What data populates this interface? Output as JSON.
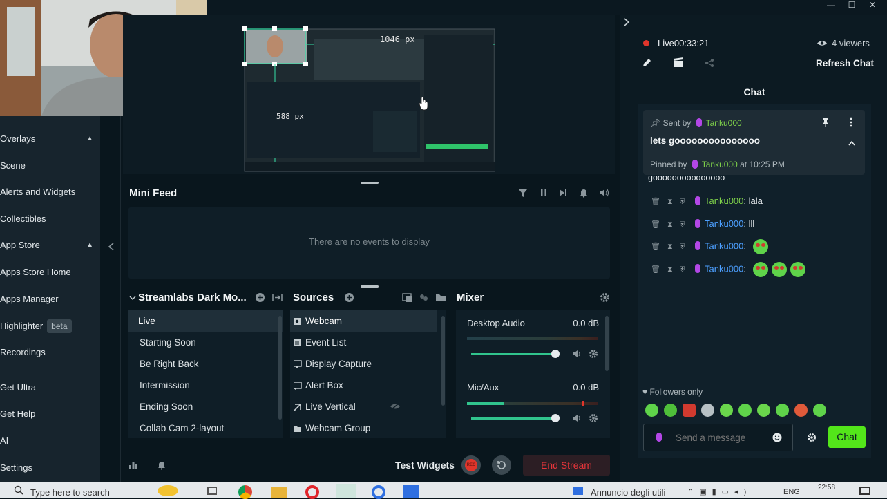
{
  "window": {
    "controls": [
      "—",
      "☐",
      "✕"
    ]
  },
  "sidebar": {
    "items": [
      {
        "label": "Overlays",
        "chevron": "▲"
      },
      {
        "label": "Scene"
      },
      {
        "label": "Alerts and Widgets"
      },
      {
        "label": "Collectibles"
      },
      {
        "label": "App Store",
        "chevron": "▲"
      },
      {
        "label": "Apps Store Home"
      },
      {
        "label": "Apps Manager"
      },
      {
        "label": "Highlighter",
        "badge": "beta"
      },
      {
        "label": "Recordings"
      },
      {
        "label": "Get Ultra"
      },
      {
        "label": "Get Help"
      },
      {
        "label": "AI"
      },
      {
        "label": "Settings"
      }
    ]
  },
  "preview": {
    "width_label": "1046 px",
    "height_label": "588 px"
  },
  "minifeed": {
    "title": "Mini Feed",
    "empty": "There are no events to display"
  },
  "scenes": {
    "title": "Streamlabs Dark Mo...",
    "items": [
      "Live",
      "Starting Soon",
      "Be Right Back",
      "Intermission",
      "Ending Soon",
      "Collab Cam 2-layout"
    ],
    "selected": "Live"
  },
  "sources": {
    "title": "Sources",
    "items": [
      "Webcam",
      "Event List",
      "Display Capture",
      "Alert Box",
      "Live Vertical",
      "Webcam Group"
    ],
    "selected": "Webcam"
  },
  "mixer": {
    "title": "Mixer",
    "channels": [
      {
        "name": "Desktop Audio",
        "level": "0.0 dB"
      },
      {
        "name": "Mic/Aux",
        "level": "0.0 dB"
      }
    ]
  },
  "bottom": {
    "test_widgets": "Test Widgets",
    "rec": "REC",
    "end_stream": "End Stream"
  },
  "stream": {
    "status": "Live",
    "time": "00:33:21",
    "viewers": "4 viewers",
    "refresh": "Refresh Chat"
  },
  "chat": {
    "title": "Chat",
    "pinned": {
      "sent_by_label": "Sent by",
      "user": "Tanku000",
      "message": "lets gooooooooooooooo",
      "pinned_by_label": "Pinned by",
      "pinned_by_user": "Tanku000",
      "at": "at 10:25 PM"
    },
    "overflow_text": "gooooooooooooooo",
    "messages": [
      {
        "user": "Tanku000",
        "text": ": lala",
        "color": "green"
      },
      {
        "user": "Tanku000",
        "text": ": lll",
        "color": "blue"
      },
      {
        "user": "Tanku000",
        "text": ":",
        "color": "blue"
      },
      {
        "user": "Tanku000",
        "text": ":",
        "color": "blue"
      }
    ],
    "followers_only": "Followers only",
    "placeholder": "Send a message",
    "send": "Chat"
  },
  "taskbar": {
    "search": "Type here to search",
    "notice": "Annuncio degli utili",
    "lang": "ENG",
    "time": "22:58"
  },
  "colors": {
    "accent": "#31c48d",
    "live_red": "#e0352b",
    "chat_green": "#53e61a",
    "end_stream_bg": "#2c1e24",
    "end_stream_text": "#e8353a"
  }
}
